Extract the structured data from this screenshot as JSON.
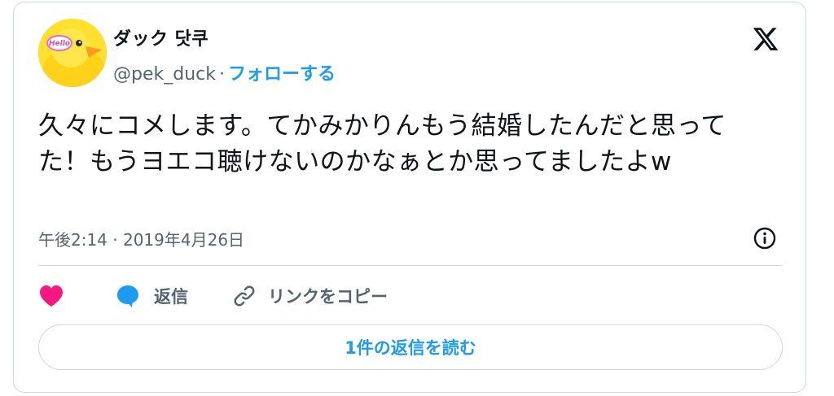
{
  "author": {
    "display_name": "ダック 닷쿠",
    "handle": "@pek_duck",
    "separator": "·",
    "follow_label": "フォローする",
    "avatar_badge_text": "Hello"
  },
  "tweet": {
    "text": "久々にコメします。てかみかりんもう結婚したんだと思ってた！もうヨエコ聴けないのかなぁとか思ってましたよw",
    "timestamp": "午後2:14 · 2019年4月26日"
  },
  "actions": {
    "reply_label": "返信",
    "copy_link_label": "リンクをコピー",
    "read_replies_label": "1件の返信を読む"
  },
  "icons": {
    "brand": "x-logo-icon",
    "info": "info-icon",
    "like": "heart-icon",
    "reply": "speech-bubble-icon",
    "link": "link-icon"
  },
  "colors": {
    "accent": "#1d9bf0",
    "like": "#f91880",
    "muted": "#536471",
    "border": "#cfd9de",
    "text": "#0f1419"
  }
}
